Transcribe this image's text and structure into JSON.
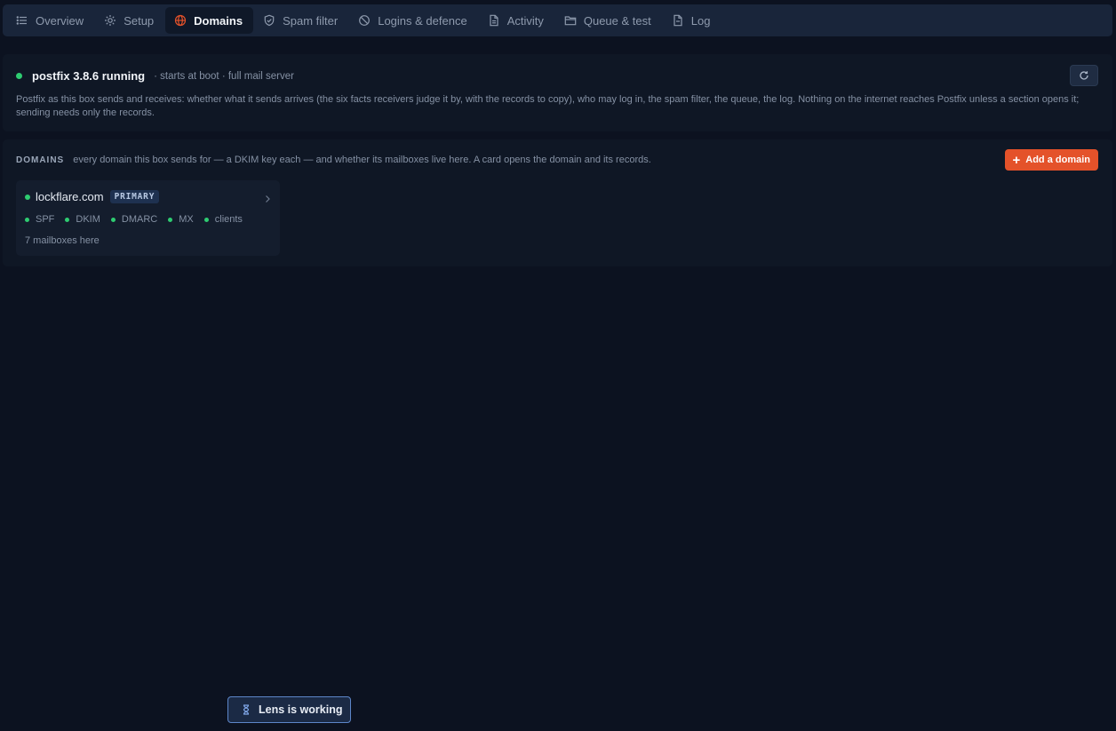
{
  "tabs": [
    {
      "label": "Overview",
      "icon": "list-icon",
      "active": false
    },
    {
      "label": "Setup",
      "icon": "gear-icon",
      "active": false
    },
    {
      "label": "Domains",
      "icon": "globe-icon",
      "active": true
    },
    {
      "label": "Spam filter",
      "icon": "shield-icon",
      "active": false
    },
    {
      "label": "Logins & defence",
      "icon": "block-icon",
      "active": false
    },
    {
      "label": "Activity",
      "icon": "document-icon",
      "active": false
    },
    {
      "label": "Queue & test",
      "icon": "folder-icon",
      "active": false
    },
    {
      "label": "Log",
      "icon": "file-icon",
      "active": false
    }
  ],
  "status": {
    "title": "postfix 3.8.6 running",
    "subtitle": "· starts at boot · full mail server",
    "description": "Postfix as this box sends and receives: whether what it sends arrives (the six facts receivers judge it by, with the records to copy), who may log in, the spam filter, the queue, the log. Nothing on the internet reaches Postfix unless a section opens it; sending needs only the records.",
    "state_color": "#2ecc71"
  },
  "domains_section": {
    "label": "DOMAINS",
    "description": "every domain this box sends for — a DKIM key each — and whether its mailboxes live here. A card opens the domain and its records.",
    "add_label": "Add a domain",
    "accent_color": "#e4522a"
  },
  "domain_cards": [
    {
      "name": "lockflare.com",
      "badge": "PRIMARY",
      "checks": [
        "SPF",
        "DKIM",
        "DMARC",
        "MX",
        "clients"
      ],
      "mailboxes": "7 mailboxes here"
    }
  ],
  "toast": {
    "text": "Lens is working",
    "icon": "hourglass-icon"
  }
}
